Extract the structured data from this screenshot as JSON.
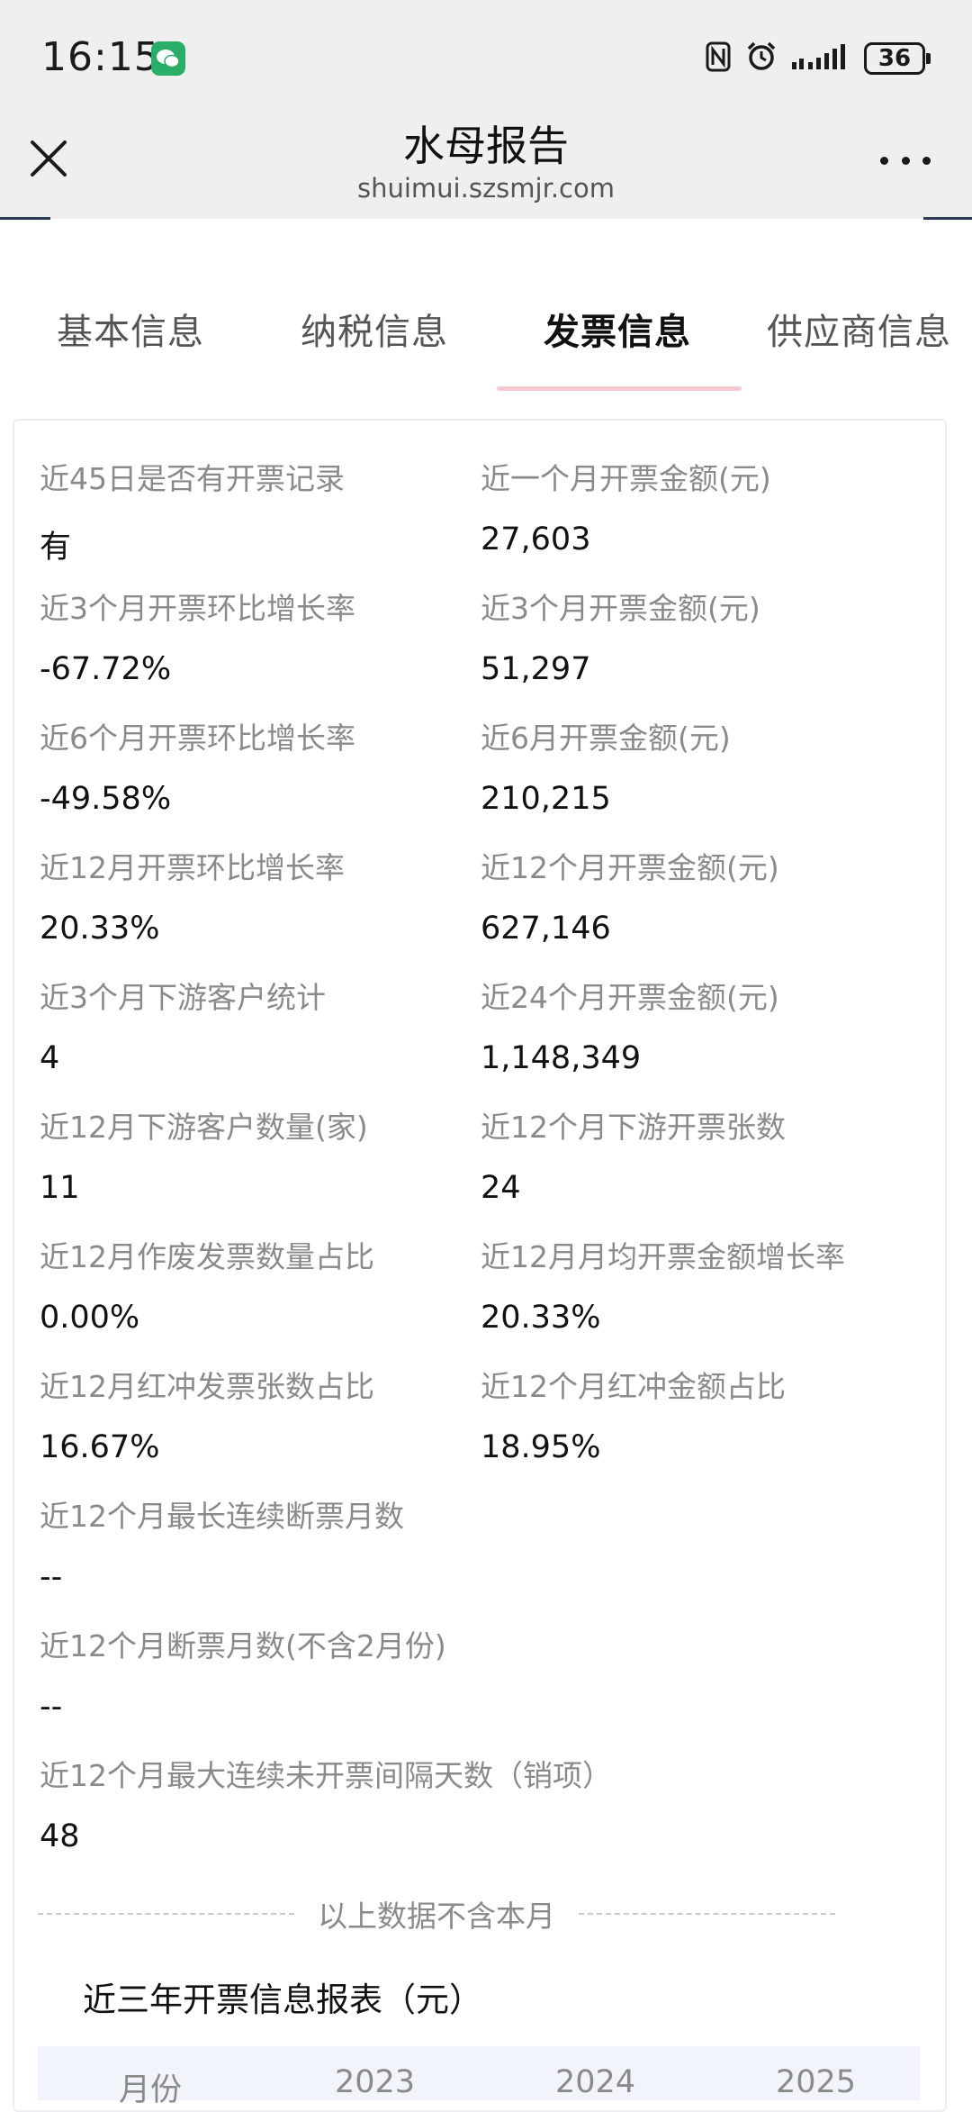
{
  "status_bar": {
    "time": "16:15",
    "battery": "36"
  },
  "header": {
    "title": "水母报告",
    "url": "shuimui.szsmjr.com"
  },
  "tabs": [
    {
      "label": "基本信息",
      "active": false
    },
    {
      "label": "纳税信息",
      "active": false
    },
    {
      "label": "发票信息",
      "active": true
    },
    {
      "label": "供应商信息",
      "active": false
    }
  ],
  "metrics": [
    {
      "label": "近45日是否有开票记录",
      "value": "有"
    },
    {
      "label": "近一个月开票金额(元)",
      "value": "27,603"
    },
    {
      "label": "近3个月开票环比增长率",
      "value": "-67.72%"
    },
    {
      "label": "近3个月开票金额(元)",
      "value": "51,297"
    },
    {
      "label": "近6个月开票环比增长率",
      "value": "-49.58%"
    },
    {
      "label": "近6月开票金额(元)",
      "value": "210,215"
    },
    {
      "label": "近12月开票环比增长率",
      "value": "20.33%"
    },
    {
      "label": "近12个月开票金额(元)",
      "value": "627,146"
    },
    {
      "label": "近3个月下游客户统计",
      "value": "4"
    },
    {
      "label": "近24个月开票金额(元)",
      "value": "1,148,349"
    },
    {
      "label": "近12月下游客户数量(家)",
      "value": "11"
    },
    {
      "label": "近12个月下游开票张数",
      "value": "24"
    },
    {
      "label": "近12月作废发票数量占比",
      "value": "0.00%"
    },
    {
      "label": "近12月月均开票金额增长率",
      "value": "20.33%"
    },
    {
      "label": "近12月红冲发票张数占比",
      "value": "16.67%"
    },
    {
      "label": "近12个月红冲金额占比",
      "value": "18.95%"
    },
    {
      "label": "近12个月最长连续断票月数",
      "value": "--"
    },
    {
      "label": "近12个月断票月数(不含2月份)",
      "value": "--"
    },
    {
      "label": "近12个月最大连续未开票间隔天数（销项）",
      "value": "48"
    }
  ],
  "note": "以上数据不含本月",
  "report": {
    "title": "近三年开票信息报表（元）",
    "columns": [
      "月份",
      "2023",
      "2024",
      "2025"
    ]
  },
  "colors": {
    "topbar": "#efefef",
    "tab_indicator": "#f3c8cf",
    "wechat": "#2aae67"
  }
}
